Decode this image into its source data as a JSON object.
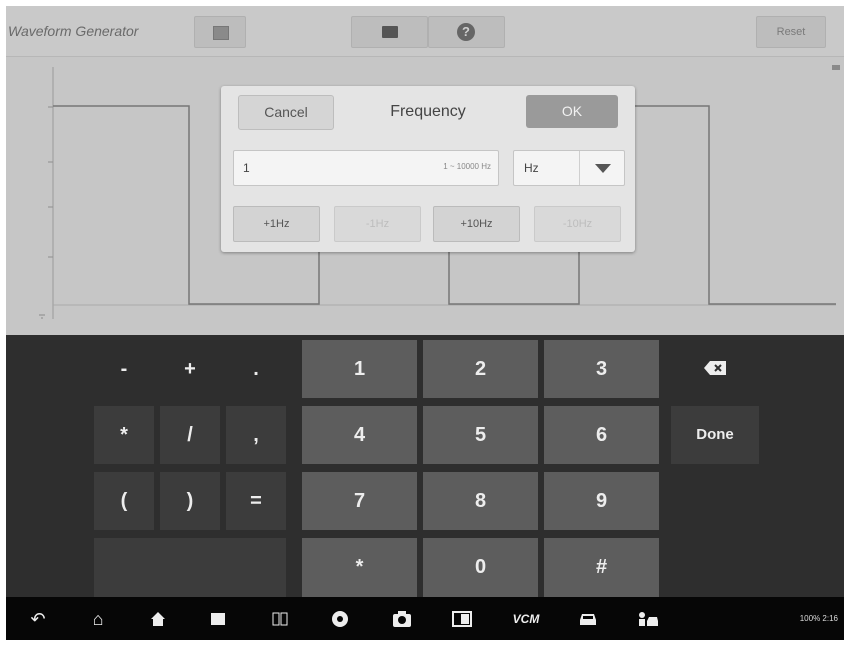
{
  "app": {
    "title": "Waveform Generator",
    "reset_label": "Reset",
    "stop_icon": "stop-icon",
    "folder_icon": "folder-icon",
    "help_icon": "help-icon"
  },
  "dialog": {
    "title": "Frequency",
    "cancel_label": "Cancel",
    "ok_label": "OK",
    "input_value": "1",
    "range_hint": "1 ~ 10000 Hz",
    "unit_value": "Hz",
    "steps": [
      {
        "label": "+1Hz",
        "enabled": true
      },
      {
        "label": "-1Hz",
        "enabled": false
      },
      {
        "label": "+10Hz",
        "enabled": true
      },
      {
        "label": "-10Hz",
        "enabled": false
      }
    ]
  },
  "keyboard": {
    "minus": "-",
    "plus": "+",
    "dot": ".",
    "asterisk": "*",
    "slash": "/",
    "comma": ",",
    "paren_open": "(",
    "paren_close": ")",
    "equals": "=",
    "one": "1",
    "two": "2",
    "three": "3",
    "four": "4",
    "five": "5",
    "six": "6",
    "seven": "7",
    "eight": "8",
    "nine": "9",
    "star": "*",
    "zero": "0",
    "hash": "#",
    "done_label": "Done",
    "backspace_icon": "backspace-icon"
  },
  "navbar": {
    "vcm_label": "VCM",
    "status_text": "100% 2:16",
    "icons": [
      "back-icon",
      "home-icon",
      "house-icon",
      "recent-apps-icon",
      "split-icon",
      "browser-icon",
      "camera-icon",
      "screen-icon",
      "vcm-icon",
      "car-icon",
      "person-car-icon"
    ]
  },
  "colors": {
    "background_dim": "#cfcfcf",
    "keyboard_bg": "#2e2e2e",
    "number_key": "#5d5d5d",
    "ok_button": "#9a9a9a",
    "navbar_bg": "#060606"
  }
}
